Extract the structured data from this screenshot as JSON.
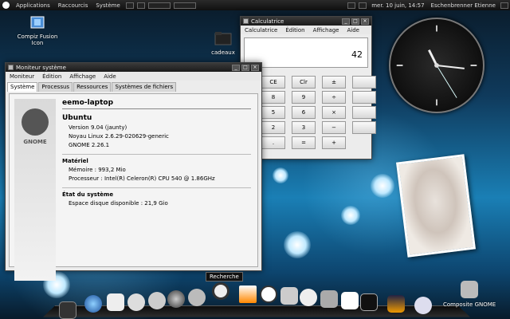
{
  "top_panel": {
    "menus": [
      "Applications",
      "Raccourcis",
      "Système"
    ],
    "clock": "mer. 10 juin, 14:57",
    "user": "Eschenbrenner Etienne"
  },
  "desktop": {
    "icons": [
      {
        "label": "Compiz Fusion Icon"
      },
      {
        "label": "cadeaux"
      }
    ]
  },
  "calculator": {
    "title": "Calculatrice",
    "menus": [
      "Calculatrice",
      "Édition",
      "Affichage",
      "Aide"
    ],
    "display": "42",
    "keys": [
      "CE",
      "Clr",
      "±",
      "8",
      "9",
      "÷",
      "5",
      "6",
      "×",
      "2",
      "3",
      "−",
      ".",
      "=",
      "+"
    ]
  },
  "sysmon": {
    "title": "Moniteur système",
    "menus": [
      "Moniteur",
      "Édition",
      "Affichage",
      "Aide"
    ],
    "tabs": [
      "Système",
      "Processus",
      "Ressources",
      "Systèmes de fichiers"
    ],
    "logo_text": "GNOME",
    "hostname": "eemo-laptop",
    "os_name": "Ubuntu",
    "version": "Version 9.04 (jaunty)",
    "kernel": "Noyau Linux 2.6.29-020629-generic",
    "gnome": "GNOME 2.26.1",
    "hardware_title": "Matériel",
    "memory": "Mémoire :   993,2 Mio",
    "processor": "Processeur : Intel(R) Celeron(R) CPU        540  @ 1.86GHz",
    "status_title": "État du système",
    "disk": "Espace disque disponible : 21,9 Gio"
  },
  "dock": {
    "tooltip": "Recherche",
    "label": "Composite GNOME"
  },
  "colors": {
    "accent": "#1a7fb5",
    "panel": "#101010"
  }
}
